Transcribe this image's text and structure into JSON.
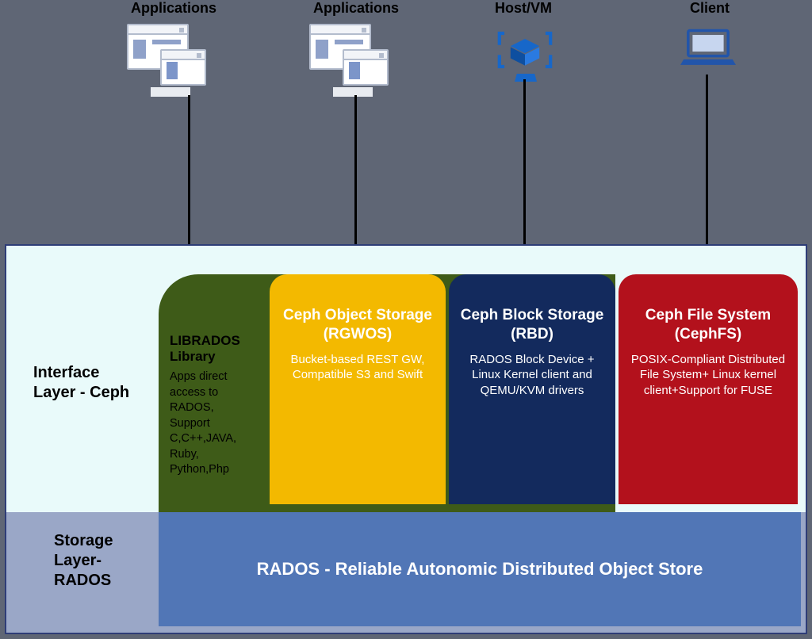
{
  "clients": {
    "app1": {
      "label": "Applications"
    },
    "app2": {
      "label": "Applications"
    },
    "vm": {
      "label": "Host/VM"
    },
    "pc": {
      "label": "Client"
    }
  },
  "layers": {
    "interface": "Interface Layer - Ceph",
    "storage": "Storage Layer- RADOS"
  },
  "blocks": {
    "librados": {
      "title": "LIBRADOS Library",
      "desc": "Apps direct access to RADOS, Support C,C++,JAVA, Ruby, Python,Php"
    },
    "rgw": {
      "title": "Ceph Object Storage (RGWOS)",
      "desc": "Bucket-based REST GW, Compatible S3 and Swift"
    },
    "rbd": {
      "title": "Ceph Block Storage (RBD)",
      "desc": "RADOS Block Device + Linux Kernel client and QEMU/KVM drivers"
    },
    "cephfs": {
      "title": "Ceph File System (CephFS)",
      "desc": "POSIX-Compliant Distributed File System+ Linux kernel client+Support for FUSE"
    }
  },
  "rados": "RADOS - Reliable Autonomic Distributed Object Store"
}
